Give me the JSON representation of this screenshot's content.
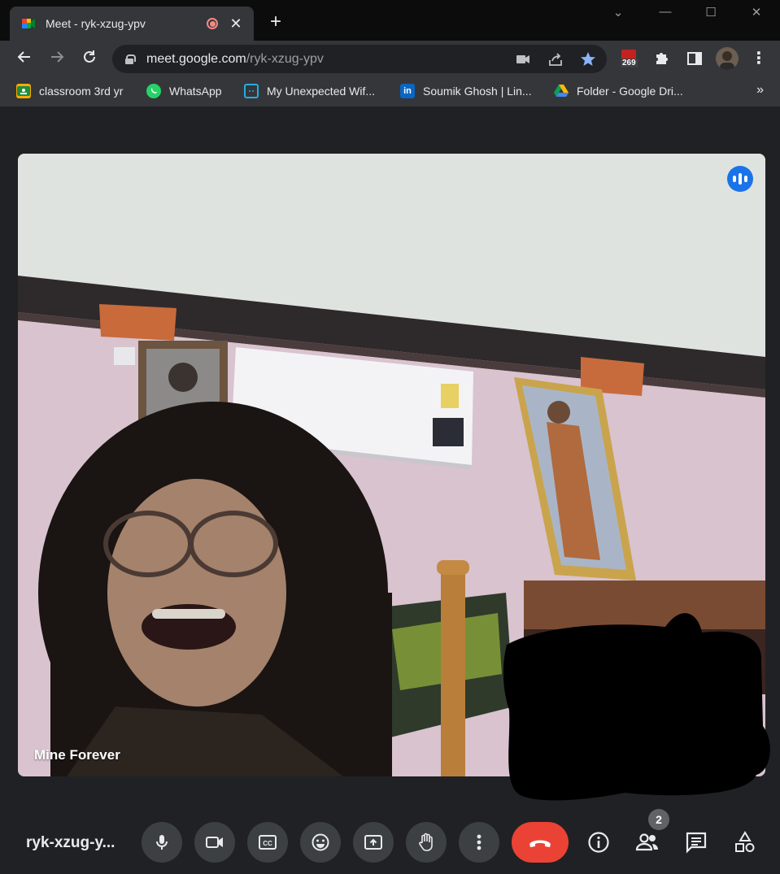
{
  "browser": {
    "tab": {
      "title": "Meet - ryk-xzug-ypv",
      "close": "✕",
      "recording_icon": "recording-dot-icon"
    },
    "new_tab": "+",
    "window_controls": {
      "minimize": "—",
      "maximize": "☐",
      "close": "✕",
      "tab_search": "⌄"
    },
    "address": {
      "host": "meet.google.com",
      "path": "/ryk-xzug-ypv"
    },
    "extension_badge": "269",
    "bookmarks": [
      {
        "label": "classroom 3rd yr",
        "icon": "google-classroom-icon"
      },
      {
        "label": "WhatsApp",
        "icon": "whatsapp-icon"
      },
      {
        "label": "My Unexpected Wif...",
        "icon": "bilibili-icon"
      },
      {
        "label": "Soumik Ghosh | Lin...",
        "icon": "linkedin-icon"
      },
      {
        "label": "Folder - Google Dri...",
        "icon": "google-drive-icon"
      }
    ],
    "bookmarks_more": "»"
  },
  "meet": {
    "participant_name": "Mine Forever",
    "meeting_code": "ryk-xzug-y...",
    "participant_count": "2",
    "controls": [
      "microphone",
      "camera",
      "captions",
      "reactions",
      "present",
      "raise-hand",
      "more-options",
      "leave-call"
    ],
    "right_controls": [
      "meeting-details",
      "people",
      "chat",
      "activities"
    ]
  },
  "colors": {
    "accent_blue": "#1a73e8",
    "hangup_red": "#ea4335",
    "control_gray": "#3c4043",
    "background": "#202124"
  }
}
